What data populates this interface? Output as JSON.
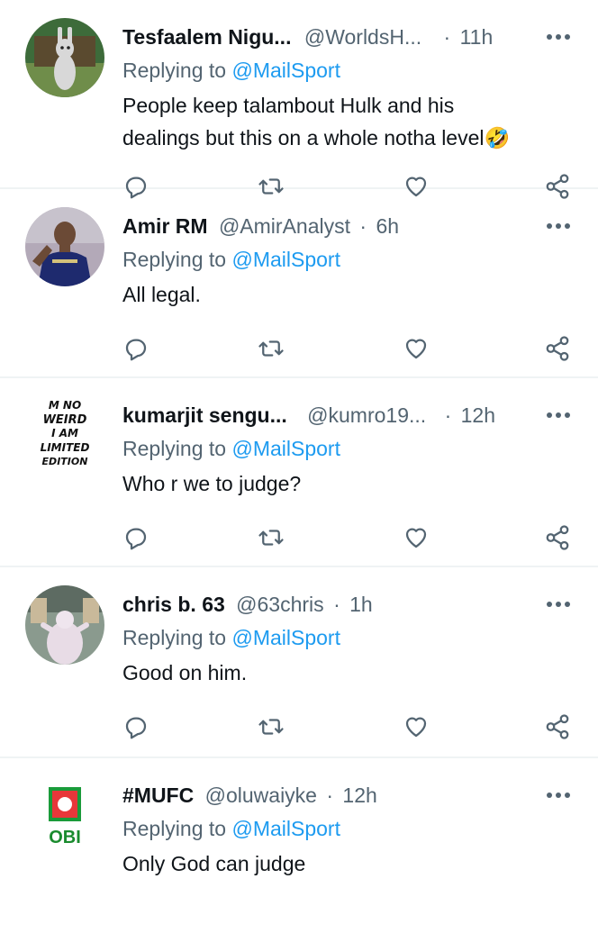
{
  "replying_prefix": "Replying to",
  "accent": "#1d9bf0",
  "tweets": [
    {
      "name": "Tesfaalem Nigu...",
      "handle": "@WorldsH...",
      "separator": "·",
      "time": "11h",
      "mention": "@MailSport",
      "text_line1": "People keep talambout Hulk and his",
      "text_line2": "dealings but this on a whole notha level",
      "emoji": "🤣",
      "avatar": "cartoon-bunny-avatar"
    },
    {
      "name": "Amir RM",
      "handle": "@AmirAnalyst",
      "separator": "·",
      "time": "6h",
      "mention": "@MailSport",
      "text_line1": "All legal.",
      "avatar": "football-player-avatar"
    },
    {
      "name": "kumarjit sengu...",
      "handle": "@kumro19...",
      "separator": "·",
      "time": "12h",
      "mention": "@MailSport",
      "text_line1": "Who r we to judge?",
      "avatar": "text-avatar",
      "avatar_text": [
        "M NO",
        "WEIRD",
        "I AM",
        "LIMITED",
        "EDITION"
      ]
    },
    {
      "name": "chris b. 63",
      "handle": "@63chris",
      "separator": "·",
      "time": "1h",
      "mention": "@MailSport",
      "text_line1": "Good on him.",
      "avatar": "statue-avatar"
    },
    {
      "name": "#MUFC",
      "handle": "@oluwaiyke",
      "separator": "·",
      "time": "12h",
      "mention": "@MailSport",
      "text_line1": "Only God can judge",
      "avatar": "obi-logo-avatar",
      "avatar_text": "OBI"
    }
  ]
}
